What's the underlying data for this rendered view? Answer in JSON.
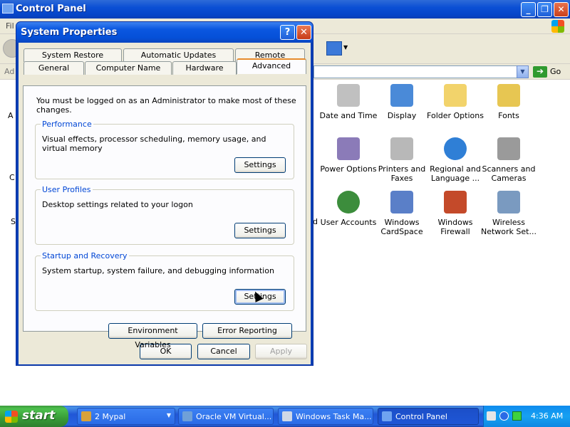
{
  "control_panel": {
    "title": "Control Panel",
    "menu_partial": "Fil",
    "address_label": "Ad",
    "go_label": "Go",
    "left_partial_letters": [
      "A",
      "C",
      "S"
    ],
    "partial_right_letter": "d",
    "items": [
      {
        "label": "Date and Time",
        "icon": "date-time-icon",
        "color": "#c0c0c0"
      },
      {
        "label": "Display",
        "icon": "display-icon",
        "color": "#4a8ad8"
      },
      {
        "label": "Folder Options",
        "icon": "folder-options-icon",
        "color": "#f2d36b"
      },
      {
        "label": "Fonts",
        "icon": "fonts-icon",
        "color": "#e7c652"
      },
      {
        "label": "Power Options",
        "icon": "power-options-icon",
        "color": "#8b7bb8"
      },
      {
        "label": "Printers and Faxes",
        "icon": "printer-icon",
        "color": "#b8b8b8"
      },
      {
        "label": "Regional and Language ...",
        "icon": "globe-icon",
        "color": "#2f7fd6"
      },
      {
        "label": "Scanners and Cameras",
        "icon": "scanner-icon",
        "color": "#9a9a9a"
      },
      {
        "label": "User Accounts",
        "icon": "user-accounts-icon",
        "color": "#3c8d3c"
      },
      {
        "label": "Windows CardSpace",
        "icon": "cardspace-icon",
        "color": "#5a7fc8"
      },
      {
        "label": "Windows Firewall",
        "icon": "firewall-icon",
        "color": "#c44a2a"
      },
      {
        "label": "Wireless Network Set...",
        "icon": "wireless-icon",
        "color": "#7a9ac0"
      }
    ]
  },
  "dialog": {
    "title": "System Properties",
    "help_label": "?",
    "close_label": "X",
    "tabs_back": [
      {
        "label": "System Restore"
      },
      {
        "label": "Automatic Updates"
      },
      {
        "label": "Remote"
      }
    ],
    "tabs_front": [
      {
        "label": "General"
      },
      {
        "label": "Computer Name"
      },
      {
        "label": "Hardware"
      },
      {
        "label": "Advanced",
        "active": true
      }
    ],
    "admin_note": "You must be logged on as an Administrator to make most of these changes.",
    "groups": [
      {
        "title": "Performance",
        "description": "Visual effects, processor scheduling, memory usage, and virtual memory",
        "button": "Settings"
      },
      {
        "title": "User Profiles",
        "description": "Desktop settings related to your logon",
        "button": "Settings"
      },
      {
        "title": "Startup and Recovery",
        "description": "System startup, system failure, and debugging information",
        "button": "Settings"
      }
    ],
    "env_button": "Environment Variables",
    "error_button": "Error Reporting",
    "ok_button": "OK",
    "cancel_button": "Cancel",
    "apply_button": "Apply"
  },
  "taskbar": {
    "start_label": "start",
    "tasks": [
      {
        "label": "2 Mypal",
        "icon": "mypal-icon",
        "active": false
      },
      {
        "label": "Oracle VM Virtual...",
        "icon": "virtualbox-icon",
        "active": false
      },
      {
        "label": "Windows Task Ma...",
        "icon": "task-manager-icon",
        "active": false
      },
      {
        "label": "Control Panel",
        "icon": "control-panel-icon",
        "active": true
      }
    ],
    "clock": "4:36 AM"
  }
}
